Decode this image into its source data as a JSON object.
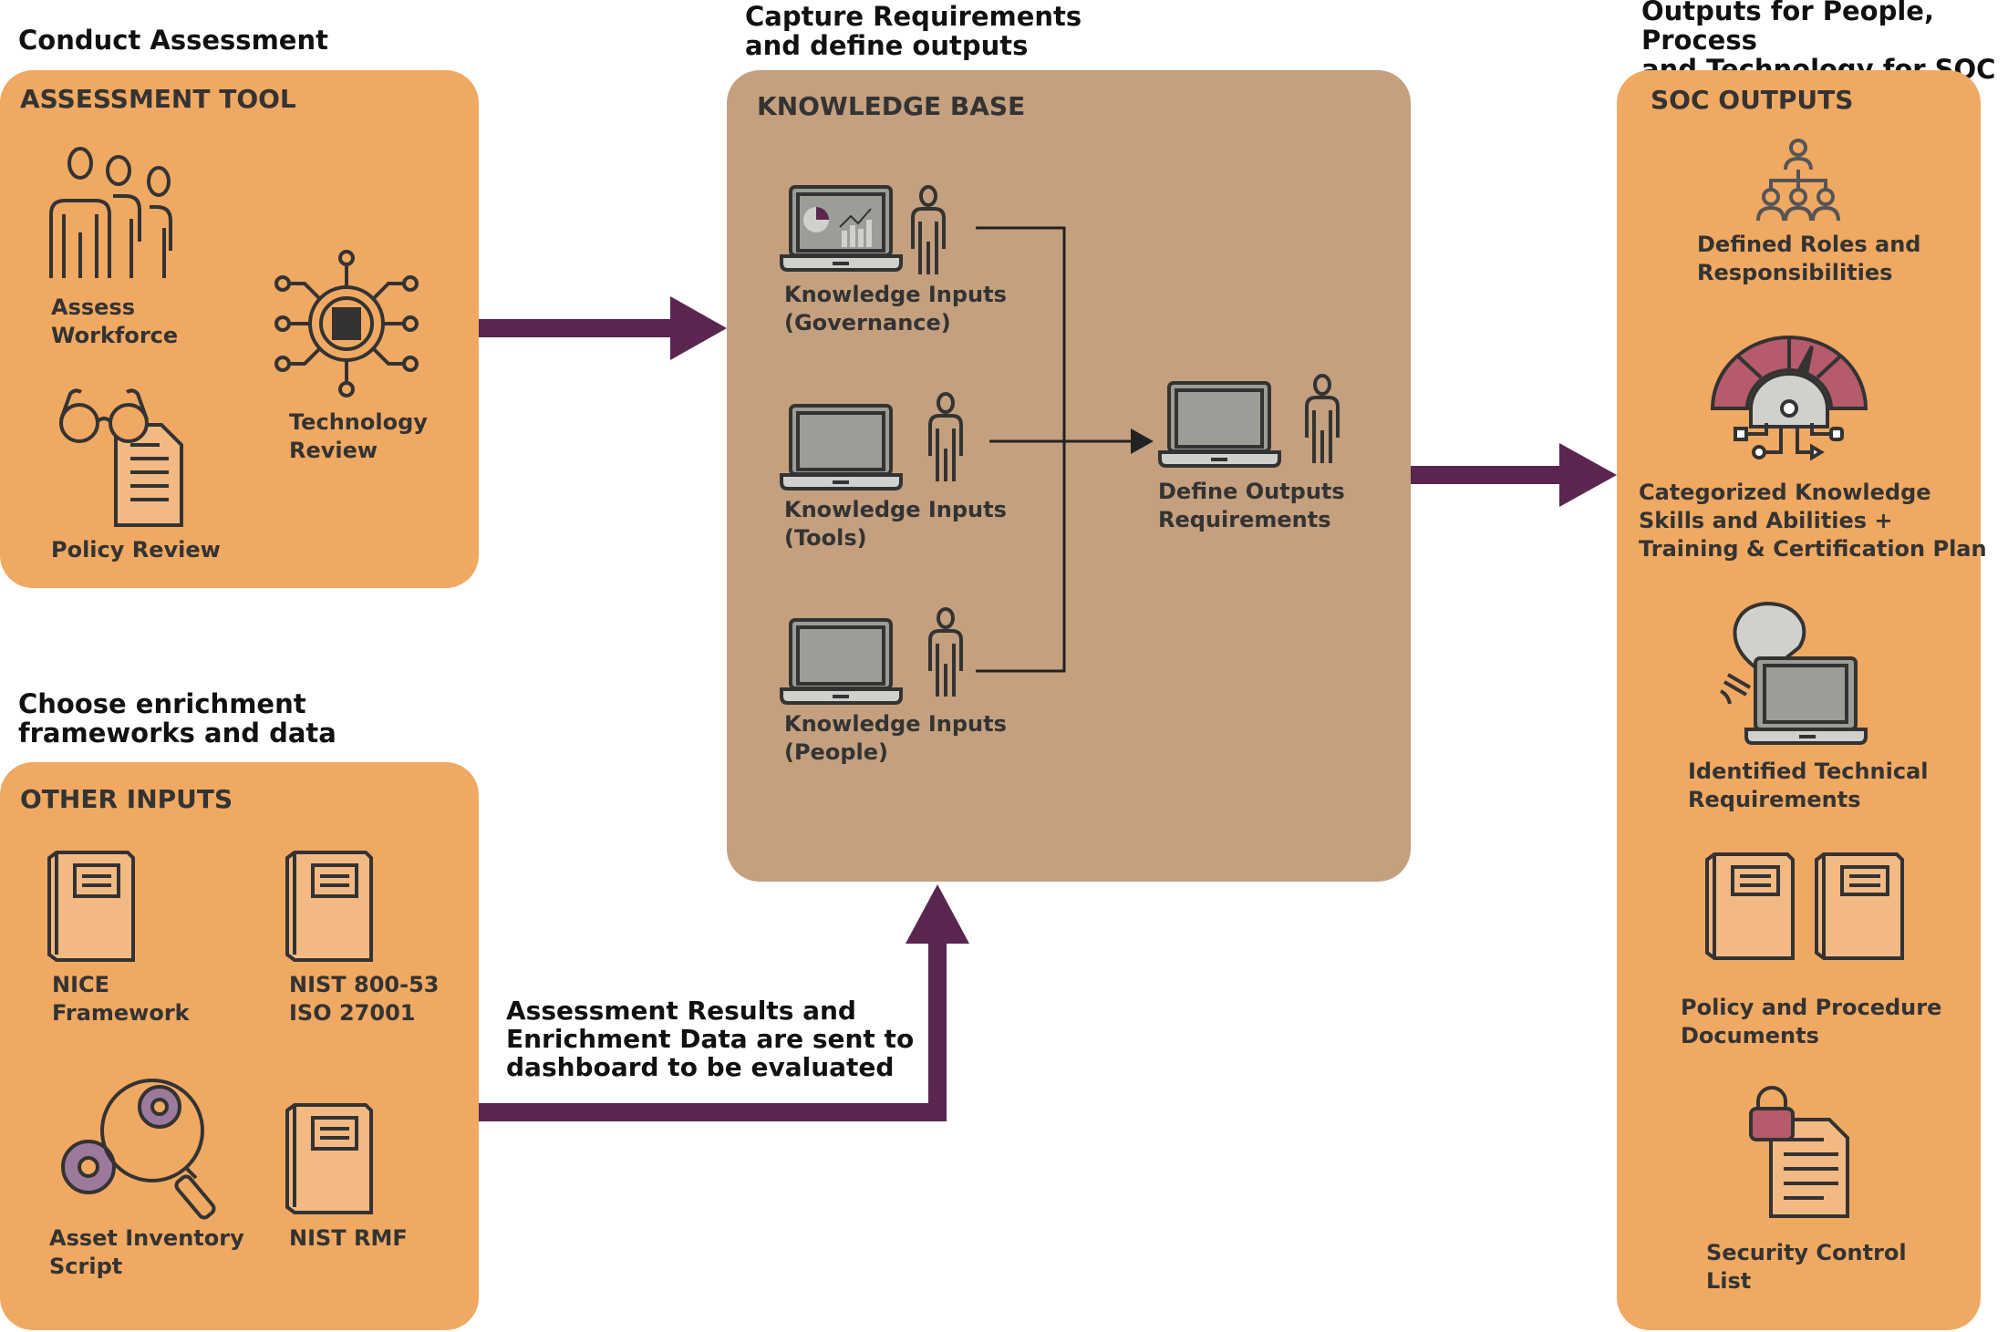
{
  "headings": {
    "conduct": "Conduct Assessment",
    "choose_line1": "Choose enrichment",
    "choose_line2": "frameworks and data",
    "capture_line1": "Capture Requirements",
    "capture_line2": "and define outputs",
    "outputs_line1": "Outputs for People, Process",
    "outputs_line2": "and Technology for SOC"
  },
  "assessment_tool": {
    "title": "ASSESSMENT TOOL",
    "items": [
      {
        "icon": "workforce-icon",
        "line1": "Assess",
        "line2": "Workforce"
      },
      {
        "icon": "technology-gear-icon",
        "line1": "Technology",
        "line2": "Review"
      },
      {
        "icon": "policy-review-icon",
        "line1": "Policy Review",
        "line2": ""
      }
    ]
  },
  "other_inputs": {
    "title": "OTHER INPUTS",
    "items": [
      {
        "icon": "book-icon",
        "line1": "NICE",
        "line2": "Framework"
      },
      {
        "icon": "book-icon",
        "line1": "NIST 800-53",
        "line2": "ISO 27001"
      },
      {
        "icon": "gear-search-icon",
        "line1": "Asset Inventory",
        "line2": "Script"
      },
      {
        "icon": "book-icon",
        "line1": "NIST RMF",
        "line2": ""
      }
    ]
  },
  "knowledge_base": {
    "title": "KNOWLEDGE BASE",
    "inputs": [
      {
        "line1": "Knowledge Inputs",
        "line2": "(Governance)"
      },
      {
        "line1": "Knowledge Inputs",
        "line2": "(Tools)"
      },
      {
        "line1": "Knowledge Inputs",
        "line2": "(People)"
      }
    ],
    "output": {
      "line1": "Define Outputs",
      "line2": "Requirements"
    }
  },
  "soc_outputs": {
    "title": "SOC OUTPUTS",
    "items": [
      {
        "icon": "org-chart-icon",
        "lines": [
          "Defined Roles and",
          "Responsibilities"
        ]
      },
      {
        "icon": "gauge-gear-icon",
        "lines": [
          "Categorized Knowledge",
          "Skills and Abilities +",
          "Training & Certification Plan"
        ]
      },
      {
        "icon": "lightbulb-laptop-icon",
        "lines": [
          "Identified Technical",
          "Requirements"
        ]
      },
      {
        "icon": "books-icon",
        "lines": [
          "Policy and Procedure",
          "Documents"
        ]
      },
      {
        "icon": "lock-document-icon",
        "lines": [
          "Security Control",
          "List"
        ]
      }
    ]
  },
  "flow_label": {
    "line1": "Assessment Results and",
    "line2": "Enrichment Data are sent to",
    "line3": "dashboard to be evaluated"
  },
  "colors": {
    "orange_box": "#f0a962",
    "tan_box": "#c4a07f",
    "arrow": "#5a2650",
    "icon_stroke": "#333333",
    "accent_red": "#b55b6b"
  }
}
